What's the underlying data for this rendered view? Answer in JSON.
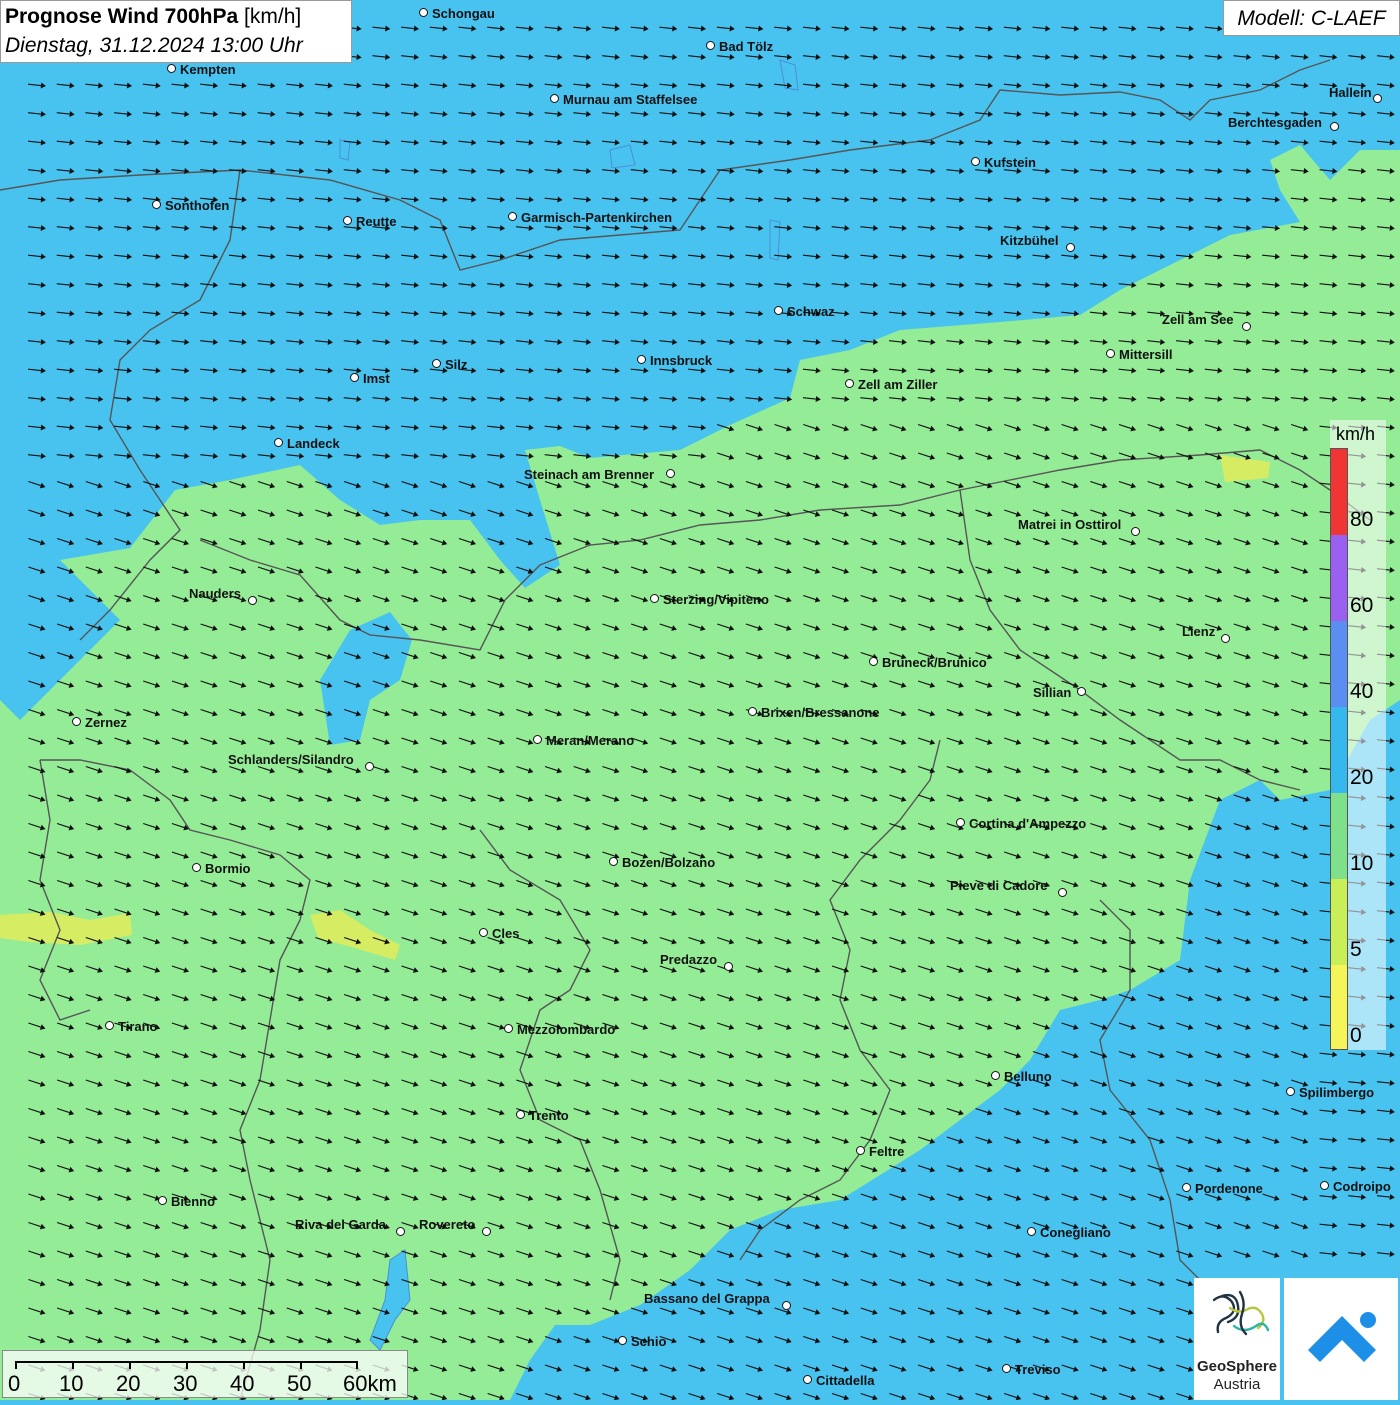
{
  "title": {
    "bold": "Prognose Wind 700hPa",
    "unit": "[km/h]",
    "datetime": "Dienstag, 31.12.2024 13:00 Uhr"
  },
  "model": "Modell: C-LAEF",
  "legend": {
    "unit": "km/h",
    "labels": [
      "80",
      "60",
      "40",
      "20",
      "10",
      "5",
      "0"
    ],
    "colors": [
      "#f03535",
      "#9a60f0",
      "#5a8ef0",
      "#35b8ee",
      "#7ee08a",
      "#c8ee58",
      "#f5f55a"
    ]
  },
  "scale": {
    "labels": [
      "0",
      "10",
      "20",
      "30",
      "40",
      "50",
      "60km"
    ]
  },
  "logos": {
    "geosphere_line1": "GeoSphere",
    "geosphere_line2": "Austria"
  },
  "colors": {
    "wind_low": "#95ec96",
    "wind_mid": "#48c3f0",
    "wind_calm": "#e2ec5a",
    "border": "#555555"
  },
  "cities": [
    {
      "name": "Schongau"
    },
    {
      "name": "Bad Tölz"
    },
    {
      "name": "Kempten"
    },
    {
      "name": "Murnau am Staffelsee"
    },
    {
      "name": "Hallein"
    },
    {
      "name": "Berchtesgaden"
    },
    {
      "name": "Kufstein"
    },
    {
      "name": "Sonthofen"
    },
    {
      "name": "Reutte"
    },
    {
      "name": "Garmisch-Partenkirchen"
    },
    {
      "name": "Kitzbühel"
    },
    {
      "name": "Schwaz"
    },
    {
      "name": "Zell am See"
    },
    {
      "name": "Mittersill"
    },
    {
      "name": "Innsbruck"
    },
    {
      "name": "Silz"
    },
    {
      "name": "Imst"
    },
    {
      "name": "Zell am Ziller"
    },
    {
      "name": "Landeck"
    },
    {
      "name": "Steinach am Brenner"
    },
    {
      "name": "Matrei in Osttirol"
    },
    {
      "name": "Nauders"
    },
    {
      "name": "Sterzing/Vipiteno"
    },
    {
      "name": "Lienz"
    },
    {
      "name": "Bruneck/Brunico"
    },
    {
      "name": "Sillian"
    },
    {
      "name": "Brixen/Bressanone"
    },
    {
      "name": "Zernez"
    },
    {
      "name": "Meran/Merano"
    },
    {
      "name": "Schlanders/Silandro"
    },
    {
      "name": "Cortina d'Ampezzo"
    },
    {
      "name": "Bozen/Bolzano"
    },
    {
      "name": "Bormio"
    },
    {
      "name": "Pieve di Cadore"
    },
    {
      "name": "Cles"
    },
    {
      "name": "Predazzo"
    },
    {
      "name": "Tirano"
    },
    {
      "name": "Mezzolombardo"
    },
    {
      "name": "Belluno"
    },
    {
      "name": "Spilimbergo"
    },
    {
      "name": "Trento"
    },
    {
      "name": "Feltre"
    },
    {
      "name": "Pordenone"
    },
    {
      "name": "Codroipo"
    },
    {
      "name": "Bienno"
    },
    {
      "name": "Riva del Garda"
    },
    {
      "name": "Rovereto"
    },
    {
      "name": "Conegliano"
    },
    {
      "name": "Bassano del Grappa"
    },
    {
      "name": "Schio"
    },
    {
      "name": "Treviso"
    },
    {
      "name": "Cittadella"
    }
  ]
}
